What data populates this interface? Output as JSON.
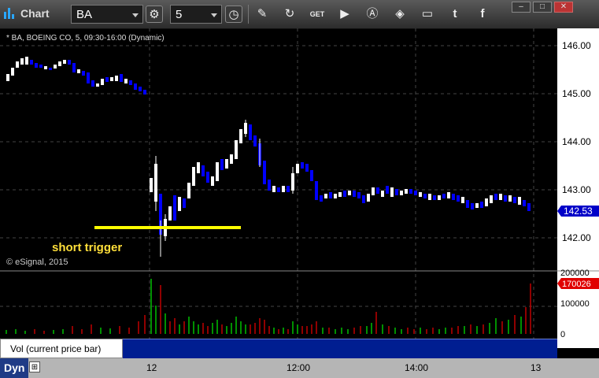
{
  "toolbar": {
    "title": "Chart",
    "symbol": "BA",
    "interval": "5",
    "icons": [
      "gear-icon",
      "clock-icon",
      "pencil-icon",
      "refresh-icon",
      "get-icon",
      "play-icon",
      "a-icon",
      "tag-icon",
      "comment-icon",
      "twitter-icon",
      "facebook-icon"
    ],
    "window_buttons": [
      "–",
      "□",
      "✕"
    ]
  },
  "chart": {
    "header": "* BA, BOEING CO, 5, 09:30-16:00 (Dynamic)",
    "watermark": "© eSignal, 2015",
    "annotation": "short trigger",
    "price_labels": [
      "146.00",
      "145.00",
      "144.00",
      "143.00",
      "142.00"
    ],
    "last_price": "142.53",
    "volume_labels": [
      "200000",
      "100000",
      "0"
    ],
    "last_volume": "170026",
    "volume_study": "Vol (current price bar)",
    "volume_close": "×",
    "time_labels": [
      "12",
      "12:00",
      "14:00",
      "13"
    ],
    "dyn": "Dyn",
    "dyn_icon": "fit-icon",
    "colors": {
      "up": "#ffffff",
      "down": "#0000ff",
      "trigger": "#ffff00",
      "vol_up": "#00c000",
      "vol_down": "#c00000",
      "last": "#e00000"
    }
  }
}
